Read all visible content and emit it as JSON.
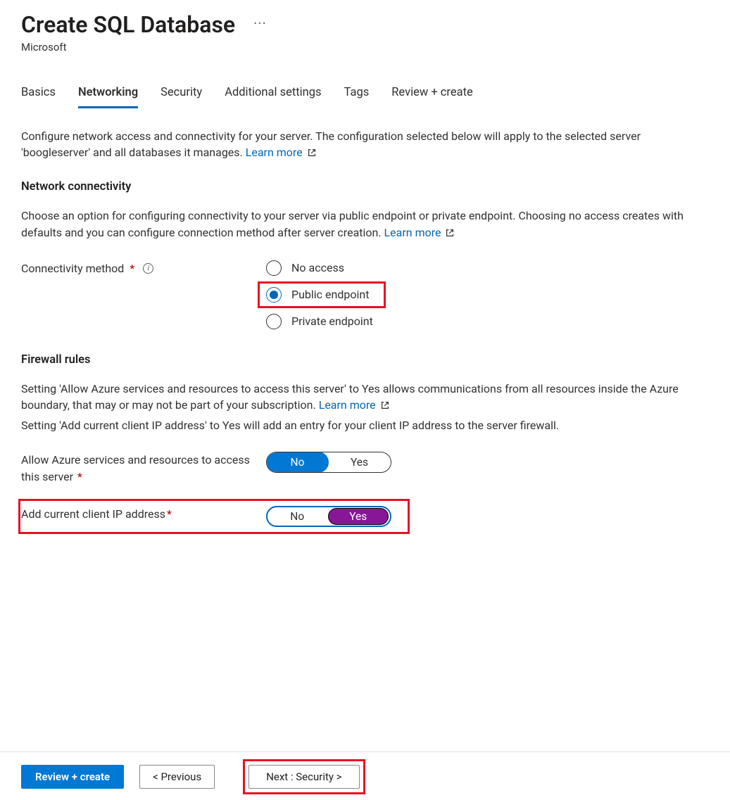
{
  "header": {
    "title": "Create SQL Database",
    "subtitle": "Microsoft"
  },
  "tabs": [
    "Basics",
    "Networking",
    "Security",
    "Additional settings",
    "Tags",
    "Review + create"
  ],
  "activeTab": "Networking",
  "intro": {
    "text": "Configure network access and connectivity for your server. The configuration selected below will apply to the selected server 'boogleserver' and all databases it manages. ",
    "link": "Learn more"
  },
  "connectivity": {
    "heading": "Network connectivity",
    "desc": "Choose an option for configuring connectivity to your server via public endpoint or private endpoint. Choosing no access creates with defaults and you can configure connection method after server creation. ",
    "link": "Learn more",
    "fieldLabel": "Connectivity method",
    "options": [
      "No access",
      "Public endpoint",
      "Private endpoint"
    ],
    "selected": "Public endpoint"
  },
  "firewall": {
    "heading": "Firewall rules",
    "p1a": "Setting 'Allow Azure services and resources to access this server' to Yes allows communications from all resources inside the Azure boundary, that may or may not be part of your subscription. ",
    "p1link": "Learn more",
    "p2": "Setting 'Add current client IP address' to Yes will add an entry for your client IP address to the server firewall.",
    "toggle1": {
      "label": "Allow Azure services and resources to access this server",
      "no": "No",
      "yes": "Yes",
      "value": "No"
    },
    "toggle2": {
      "label": "Add current client IP address",
      "no": "No",
      "yes": "Yes",
      "value": "Yes"
    }
  },
  "footer": {
    "review": "Review + create",
    "prev": "<  Previous",
    "next": "Next : Security >"
  }
}
